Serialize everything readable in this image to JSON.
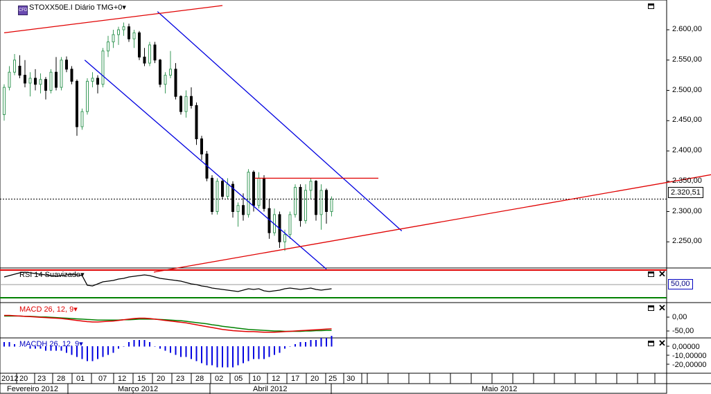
{
  "chart_data": {
    "type": "candlestick",
    "title": "STOXX50E.I Diário TMG+0",
    "instrument": "STOXX50E.I",
    "timeframe": "Diário",
    "timezone": "TMG+0",
    "current_price": "2.320,51",
    "ylim": [
      2200,
      2640
    ],
    "y_ticks": [
      "2.600,00",
      "2.550,00",
      "2.500,00",
      "2.450,00",
      "2.400,00",
      "2.350,00",
      "2.300,00",
      "2.250,00"
    ],
    "y_tick_values": [
      2600,
      2550,
      2500,
      2450,
      2400,
      2350,
      2300,
      2250
    ],
    "candles": [
      {
        "date": "2012-02-15",
        "o": 2460,
        "h": 2510,
        "l": 2450,
        "c": 2505
      },
      {
        "date": "2012-02-16",
        "o": 2505,
        "h": 2540,
        "l": 2500,
        "c": 2530
      },
      {
        "date": "2012-02-17",
        "o": 2530,
        "h": 2560,
        "l": 2525,
        "c": 2550
      },
      {
        "date": "2012-02-20",
        "o": 2540,
        "h": 2558,
        "l": 2520,
        "c": 2525
      },
      {
        "date": "2012-02-21",
        "o": 2525,
        "h": 2550,
        "l": 2505,
        "c": 2512
      },
      {
        "date": "2012-02-22",
        "o": 2512,
        "h": 2530,
        "l": 2490,
        "c": 2520
      },
      {
        "date": "2012-02-23",
        "o": 2520,
        "h": 2535,
        "l": 2500,
        "c": 2510
      },
      {
        "date": "2012-02-24",
        "o": 2510,
        "h": 2528,
        "l": 2495,
        "c": 2518
      },
      {
        "date": "2012-02-27",
        "o": 2518,
        "h": 2522,
        "l": 2485,
        "c": 2500
      },
      {
        "date": "2012-02-28",
        "o": 2500,
        "h": 2535,
        "l": 2495,
        "c": 2530
      },
      {
        "date": "2012-02-29",
        "o": 2530,
        "h": 2555,
        "l": 2500,
        "c": 2505
      },
      {
        "date": "2012-03-01",
        "o": 2505,
        "h": 2555,
        "l": 2500,
        "c": 2550
      },
      {
        "date": "2012-03-02",
        "o": 2550,
        "h": 2556,
        "l": 2530,
        "c": 2535
      },
      {
        "date": "2012-03-05",
        "o": 2535,
        "h": 2540,
        "l": 2510,
        "c": 2515
      },
      {
        "date": "2012-03-06",
        "o": 2515,
        "h": 2518,
        "l": 2425,
        "c": 2440
      },
      {
        "date": "2012-03-07",
        "o": 2440,
        "h": 2470,
        "l": 2435,
        "c": 2465
      },
      {
        "date": "2012-03-08",
        "o": 2465,
        "h": 2520,
        "l": 2460,
        "c": 2515
      },
      {
        "date": "2012-03-09",
        "o": 2515,
        "h": 2530,
        "l": 2505,
        "c": 2520
      },
      {
        "date": "2012-03-12",
        "o": 2520,
        "h": 2525,
        "l": 2495,
        "c": 2510
      },
      {
        "date": "2012-03-13",
        "o": 2510,
        "h": 2570,
        "l": 2505,
        "c": 2565
      },
      {
        "date": "2012-03-14",
        "o": 2565,
        "h": 2590,
        "l": 2555,
        "c": 2580
      },
      {
        "date": "2012-03-15",
        "o": 2580,
        "h": 2600,
        "l": 2570,
        "c": 2592
      },
      {
        "date": "2012-03-16",
        "o": 2592,
        "h": 2605,
        "l": 2575,
        "c": 2600
      },
      {
        "date": "2012-03-19",
        "o": 2600,
        "h": 2612,
        "l": 2590,
        "c": 2605
      },
      {
        "date": "2012-03-20",
        "o": 2605,
        "h": 2610,
        "l": 2580,
        "c": 2585
      },
      {
        "date": "2012-03-21",
        "o": 2585,
        "h": 2600,
        "l": 2570,
        "c": 2595
      },
      {
        "date": "2012-03-22",
        "o": 2595,
        "h": 2598,
        "l": 2550,
        "c": 2555
      },
      {
        "date": "2012-03-23",
        "o": 2555,
        "h": 2570,
        "l": 2540,
        "c": 2545
      },
      {
        "date": "2012-03-26",
        "o": 2545,
        "h": 2580,
        "l": 2540,
        "c": 2575
      },
      {
        "date": "2012-03-27",
        "o": 2575,
        "h": 2580,
        "l": 2545,
        "c": 2550
      },
      {
        "date": "2012-03-28",
        "o": 2550,
        "h": 2552,
        "l": 2505,
        "c": 2510
      },
      {
        "date": "2012-03-29",
        "o": 2510,
        "h": 2530,
        "l": 2495,
        "c": 2525
      },
      {
        "date": "2012-03-30",
        "o": 2525,
        "h": 2565,
        "l": 2520,
        "c": 2535
      },
      {
        "date": "2012-04-02",
        "o": 2535,
        "h": 2545,
        "l": 2485,
        "c": 2490
      },
      {
        "date": "2012-04-03",
        "o": 2490,
        "h": 2492,
        "l": 2460,
        "c": 2465
      },
      {
        "date": "2012-04-04",
        "o": 2465,
        "h": 2500,
        "l": 2455,
        "c": 2490
      },
      {
        "date": "2012-04-05",
        "o": 2490,
        "h": 2505,
        "l": 2470,
        "c": 2475
      },
      {
        "date": "2012-04-10",
        "o": 2475,
        "h": 2480,
        "l": 2410,
        "c": 2420
      },
      {
        "date": "2012-04-11",
        "o": 2420,
        "h": 2425,
        "l": 2385,
        "c": 2395
      },
      {
        "date": "2012-04-12",
        "o": 2395,
        "h": 2400,
        "l": 2350,
        "c": 2355
      },
      {
        "date": "2012-04-13",
        "o": 2355,
        "h": 2360,
        "l": 2295,
        "c": 2300
      },
      {
        "date": "2012-04-16",
        "o": 2300,
        "h": 2355,
        "l": 2295,
        "c": 2350
      },
      {
        "date": "2012-04-17",
        "o": 2350,
        "h": 2355,
        "l": 2320,
        "c": 2325
      },
      {
        "date": "2012-04-18",
        "o": 2325,
        "h": 2355,
        "l": 2320,
        "c": 2345
      },
      {
        "date": "2012-04-19",
        "o": 2345,
        "h": 2350,
        "l": 2290,
        "c": 2300
      },
      {
        "date": "2012-04-20",
        "o": 2300,
        "h": 2315,
        "l": 2275,
        "c": 2310
      },
      {
        "date": "2012-04-23",
        "o": 2310,
        "h": 2330,
        "l": 2285,
        "c": 2295
      },
      {
        "date": "2012-04-24",
        "o": 2295,
        "h": 2370,
        "l": 2290,
        "c": 2365
      },
      {
        "date": "2012-04-25",
        "o": 2365,
        "h": 2368,
        "l": 2300,
        "c": 2310
      },
      {
        "date": "2012-04-26",
        "o": 2310,
        "h": 2365,
        "l": 2305,
        "c": 2355
      },
      {
        "date": "2012-04-27",
        "o": 2355,
        "h": 2360,
        "l": 2300,
        "c": 2305
      },
      {
        "date": "2012-04-30",
        "o": 2305,
        "h": 2320,
        "l": 2255,
        "c": 2265
      },
      {
        "date": "2012-05-01",
        "o": 2265,
        "h": 2305,
        "l": 2260,
        "c": 2295
      },
      {
        "date": "2012-05-02",
        "o": 2295,
        "h": 2300,
        "l": 2240,
        "c": 2250
      },
      {
        "date": "2012-05-03",
        "o": 2250,
        "h": 2270,
        "l": 2235,
        "c": 2262
      },
      {
        "date": "2012-05-04",
        "o": 2262,
        "h": 2300,
        "l": 2255,
        "c": 2295
      },
      {
        "date": "2012-05-07",
        "o": 2295,
        "h": 2345,
        "l": 2290,
        "c": 2340
      },
      {
        "date": "2012-05-08",
        "o": 2340,
        "h": 2345,
        "l": 2275,
        "c": 2285
      },
      {
        "date": "2012-05-09",
        "o": 2285,
        "h": 2345,
        "l": 2280,
        "c": 2335
      },
      {
        "date": "2012-05-10",
        "o": 2335,
        "h": 2355,
        "l": 2320,
        "c": 2350
      },
      {
        "date": "2012-05-11",
        "o": 2350,
        "h": 2352,
        "l": 2285,
        "c": 2295
      },
      {
        "date": "2012-05-14",
        "o": 2295,
        "h": 2345,
        "l": 2270,
        "c": 2335
      },
      {
        "date": "2012-05-15",
        "o": 2335,
        "h": 2338,
        "l": 2280,
        "c": 2300
      },
      {
        "date": "2012-05-16",
        "o": 2300,
        "h": 2325,
        "l": 2292,
        "c": 2320.51
      }
    ],
    "trendlines": [
      {
        "name": "channel-upper",
        "color": "#0000e0",
        "from": {
          "i": 29.5,
          "v": 2630
        },
        "to": {
          "i": 76.5,
          "v": 2268
        }
      },
      {
        "name": "channel-lower",
        "color": "#0000e0",
        "from": {
          "i": 15.5,
          "v": 2550
        },
        "to": {
          "i": 62,
          "v": 2205
        }
      },
      {
        "name": "resistance-horizontal",
        "color": "#e00000",
        "from": {
          "i": 48.2,
          "v": 2355
        },
        "to": {
          "i": 72,
          "v": 2355
        }
      },
      {
        "name": "support-rising",
        "color": "#e00000",
        "from": {
          "i": 28.8,
          "v": 2200
        },
        "to": {
          "i": 137.5,
          "v": 2363
        }
      },
      {
        "name": "top-rising",
        "color": "#e00000",
        "from": {
          "i": 0,
          "v": 2595
        },
        "to": {
          "i": 42,
          "v": 2640
        }
      }
    ],
    "rsi": {
      "title": "RSI 14 Suavizado",
      "level": "50,00",
      "values": [
        60,
        62,
        64,
        66,
        67,
        66,
        65,
        64,
        63,
        62,
        61,
        62,
        63,
        64,
        63,
        62,
        48,
        47,
        50,
        53,
        54,
        55,
        57,
        58,
        60,
        61,
        62,
        63,
        62,
        60,
        58,
        57,
        56,
        55,
        54,
        52,
        50,
        49,
        47,
        46,
        44,
        43,
        42,
        41,
        40,
        39,
        41,
        43,
        42,
        43,
        40,
        39,
        40,
        41,
        43,
        44,
        43,
        42,
        43,
        44,
        42,
        41,
        42,
        43
      ]
    },
    "macd": {
      "title": "MACD 26, 12, 9",
      "y_ticks": [
        "0,00",
        "-50,00"
      ],
      "macd_line": [
        10,
        10,
        9,
        8,
        7,
        6,
        5,
        4,
        3,
        2,
        1,
        0,
        -2,
        -4,
        -6,
        -8,
        -10,
        -11,
        -11,
        -10,
        -9,
        -8,
        -6,
        -4,
        -2,
        0,
        1,
        1,
        0,
        -2,
        -4,
        -6,
        -8,
        -10,
        -12,
        -14,
        -17,
        -20,
        -23,
        -26,
        -29,
        -32,
        -35,
        -37,
        -39,
        -40,
        -41,
        -42,
        -42,
        -43,
        -44,
        -44,
        -44,
        -43,
        -42,
        -41,
        -40,
        -39,
        -38,
        -37,
        -36,
        -35,
        -34,
        -33
      ],
      "signal_line": [
        8,
        8,
        8,
        8,
        7,
        7,
        6,
        5,
        5,
        4,
        3,
        2,
        1,
        0,
        -1,
        -2,
        -3,
        -4,
        -5,
        -5,
        -5,
        -5,
        -5,
        -4,
        -4,
        -3,
        -2,
        -2,
        -2,
        -2,
        -3,
        -4,
        -5,
        -6,
        -7,
        -9,
        -11,
        -13,
        -15,
        -17,
        -20,
        -22,
        -25,
        -27,
        -29,
        -31,
        -33,
        -35,
        -36,
        -37,
        -38,
        -39,
        -40,
        -40,
        -41,
        -41,
        -41,
        -41,
        -40,
        -40,
        -39,
        -39,
        -38,
        -38
      ]
    },
    "macdh": {
      "title": "MACDH 26, 12, 9",
      "y_ticks": [
        "0,00000",
        "-10,00000",
        "-20,00000"
      ],
      "values": [
        2,
        2,
        1,
        0,
        0,
        -1,
        -1,
        -1,
        -2,
        -2,
        -2,
        -2,
        -3,
        -4,
        -5,
        -6,
        -7,
        -7,
        -6,
        -5,
        -4,
        -3,
        -1,
        0,
        2,
        3,
        3,
        3,
        2,
        0,
        -1,
        -2,
        -3,
        -4,
        -5,
        -5,
        -6,
        -7,
        -8,
        -9,
        -9,
        -10,
        -10,
        -10,
        -10,
        -9,
        -8,
        -7,
        -6,
        -6,
        -6,
        -5,
        -4,
        -3,
        -1,
        0,
        1,
        2,
        2,
        3,
        3,
        4,
        4,
        5
      ]
    },
    "x_ticks": [
      "2012",
      "20",
      "23",
      "28",
      "01",
      "07",
      "12",
      "15",
      "20",
      "23",
      "28",
      "02",
      "05",
      "10",
      "12",
      "17",
      "20",
      "25",
      "30"
    ],
    "months": [
      "Fevereiro 2012",
      "Março 2012",
      "Abril 2012",
      "Maio 2012"
    ]
  },
  "colors": {
    "bull": "#3a9a5a",
    "bear": "#000000",
    "trend_blue": "#0000e0",
    "trend_red": "#e00000",
    "macd_red": "#e00000",
    "macd_green": "#008000",
    "macdh_blue": "#0000e0",
    "rsi_red": "#e00000",
    "rsi_green": "#008000"
  },
  "icons": {
    "pane_maximize": "window-maximize-icon",
    "pane_close": "close-icon",
    "dropdown": "triangle-down-icon"
  }
}
